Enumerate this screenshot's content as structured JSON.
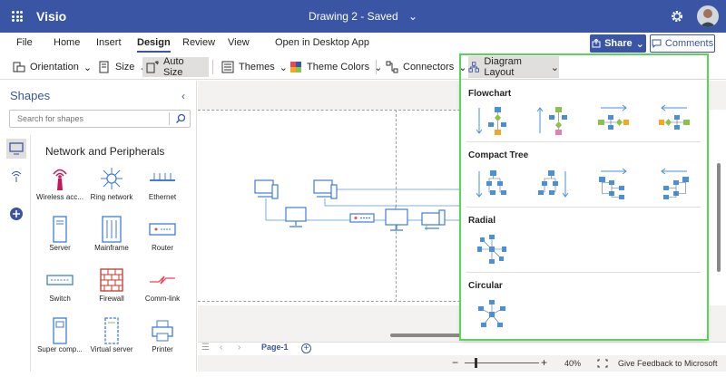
{
  "titlebar": {
    "app_name": "Visio",
    "doc_title": "Drawing 2  -  Saved",
    "chevron": "⌄",
    "waffle_icon": "app-launcher-icon",
    "settings_icon": "gear-icon",
    "background": "#3955a3"
  },
  "ribbon": {
    "tabs": [
      "File",
      "Home",
      "Insert",
      "Design",
      "Review",
      "View"
    ],
    "active_tab": "Design",
    "open_desktop": "Open in Desktop App",
    "share_label": "Share",
    "comments_label": "Comments"
  },
  "toolbar": {
    "orientation": "Orientation",
    "size": "Size",
    "auto_size": "Auto Size",
    "themes": "Themes",
    "theme_colors": "Theme Colors",
    "connectors": "Connectors",
    "diagram_layout": "Diagram Layout"
  },
  "shapes_panel": {
    "title": "Shapes",
    "search_placeholder": "Search for shapes",
    "stencil_title": "Network and Peripherals",
    "shapes": [
      "Wireless acc...",
      "Ring network",
      "Ethernet",
      "Server",
      "Mainframe",
      "Router",
      "Switch",
      "Firewall",
      "Comm-link",
      "Super comp...",
      "Virtual server",
      "Printer"
    ]
  },
  "page_tabs": {
    "page_label": "Page-1",
    "add_label": "+"
  },
  "statusbar": {
    "zoom_minus": "−",
    "zoom_plus": "+",
    "zoom": "40%",
    "zoom_level": 0.4,
    "feedback": "Give Feedback to Microsoft"
  },
  "diagram_layout": {
    "sections": [
      "Flowchart",
      "Compact Tree",
      "Radial",
      "Circular"
    ],
    "accent_green": "#5ad35a",
    "shape_blue": "#4a90d9",
    "shape_green": "#8bc34a",
    "shape_orange": "#f5a623",
    "shape_pink": "#e57eb4"
  }
}
